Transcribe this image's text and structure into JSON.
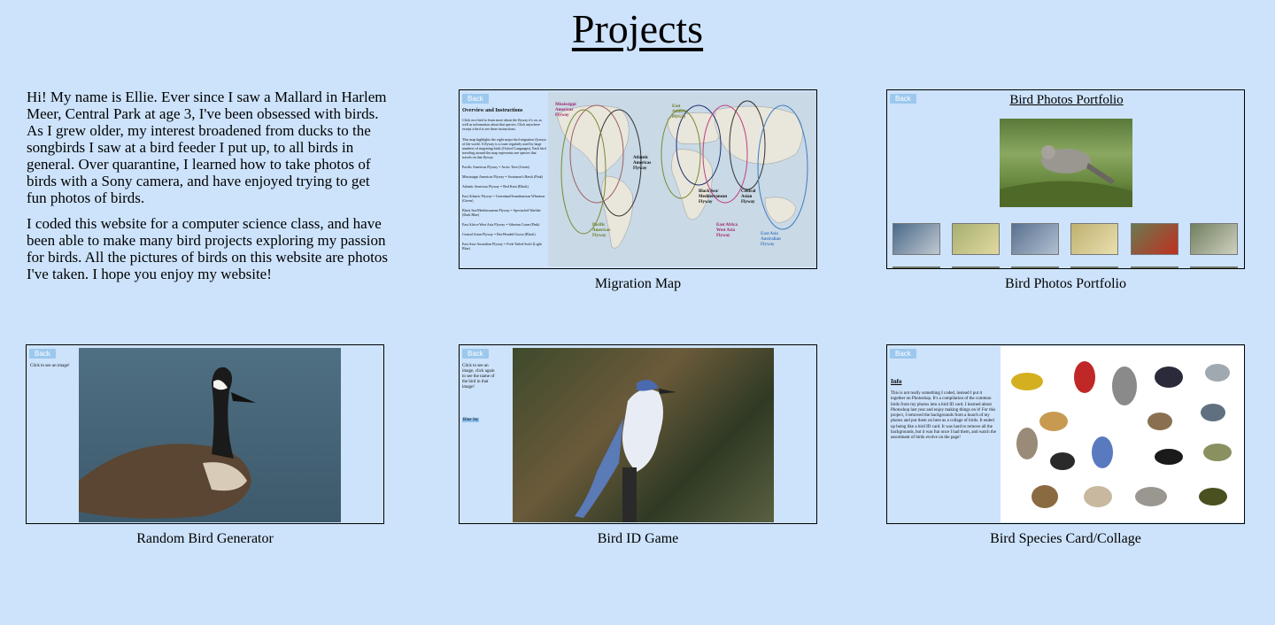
{
  "title": "Projects",
  "intro": {
    "p1": "Hi! My name is Ellie. Ever since I saw a Mallard in Harlem Meer, Central Park at age 3, I've been obsessed with birds. As I grew older, my interest broadened from ducks to the songbirds I saw at a bird feeder I put up, to all birds in general. Over quarantine, I learned how to take photos of birds with a Sony camera, and have enjoyed trying to get fun photos of birds.",
    "p2": "I coded this website for a computer science class, and have been able to make many bird projects exploring my passion for birds. All the pictures of birds on this website are photos I've taken. I hope you enjoy my website!"
  },
  "back_label": "Back",
  "projects": [
    {
      "caption": "Migration Map",
      "panel_title": "Overview and Instructions",
      "panel_text": "Click on a bird to learn more about the flyway it's on, as well as information about that species. Click anywhere except a bird to see these instructions.",
      "panel_text2": "This map highlights the eight major bird migration flyways of the world. A flyway is a route regularly used by large numbers of migrating birds (Oxford Languages). Each bird traveling around the map represents one species that travels on that flyway.",
      "flyways": [
        "Pacific Americas Flyway = Arctic Tern (Green)",
        "Mississippi Americas Flyway = Swainson's Hawk (Pink)",
        "Atlantic Americas Flyway = Red Knot (Black)",
        "East Atlantic Flyway = Greenland/Scandinavian Wheatear (Green)",
        "Black Sea/Mediterranean Flyway = Spectacled Warbler (Dark Blue)",
        "East Africa-West Asia Flyway = Siberian Crane (Pink)",
        "Central Asian Flyway = Bar-Headed Goose (Black)",
        "East Asia-Australian Flyway = Fork-Tailed Swift (Light Blue)"
      ],
      "map_labels": [
        "Mississippi Americas Flyway",
        "East Atlantic Flyway",
        "Atlantic Americas Flyway",
        "Black Sea/ Mediterranean Flyway",
        "Central Asian Flyway",
        "Pacific Americas Flyway",
        "East Africa West Asia Flyway",
        "East Asia Australian Flyway"
      ]
    },
    {
      "caption": "Bird Photos Portfolio",
      "panel_title": "Bird Photos Portfolio"
    },
    {
      "caption": "Random Bird Generator",
      "panel_text": "Click to see an image!"
    },
    {
      "caption": "Bird ID Game",
      "panel_text": "Click to see an image, click again to see the name of the bird in that image!",
      "answer": "Blue Jay"
    },
    {
      "caption": "Bird Species Card/Collage",
      "info_title": "Info",
      "info_text": "This is not really something I coded, instead I put it together on Photoshop. It's a compilation of the common birds from my photos into a bird ID card. I learned about Photoshop last year and enjoy making things on it! For this project, I removed the backgrounds from a bunch of my photos and put them on here as a collage of birds. It ended up being like a bird ID card. It was hard to remove all the backgrounds, but it was fun once I had them, and watch the assortment of birds evolve on the page!"
    }
  ],
  "colors": {
    "background": "#cde3fb",
    "back_button": "#9cc8ee"
  }
}
